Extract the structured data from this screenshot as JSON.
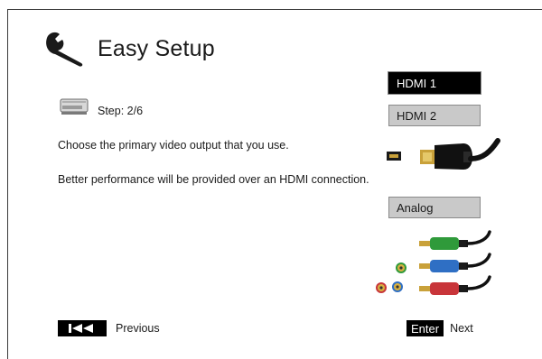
{
  "screen": {
    "title": "Easy Setup",
    "step": "Step: 2/6",
    "description": "Choose the primary video output that you use.",
    "note": "Better performance will be provided over an HDMI connection."
  },
  "options": [
    {
      "label": "HDMI 1",
      "selected": true
    },
    {
      "label": "HDMI 2",
      "selected": false
    },
    {
      "label": "Analog",
      "selected": false
    }
  ],
  "footer": {
    "previous_label": "Previous",
    "enter_key": "Enter",
    "next_label": "Next"
  },
  "icons": {
    "title": "wrench-icon",
    "step": "monitor-icon",
    "previous_key": "skip-back-icon",
    "hdmi": "hdmi-cable-icon",
    "analog": "component-rca-cables-icon"
  },
  "colors": {
    "selected_bg": "#000000",
    "selected_text": "#ffffff",
    "option_bg": "#c9c9c9",
    "rca_green": "#2f9a3a",
    "rca_blue": "#2f6fc4",
    "rca_red": "#c8353a"
  }
}
